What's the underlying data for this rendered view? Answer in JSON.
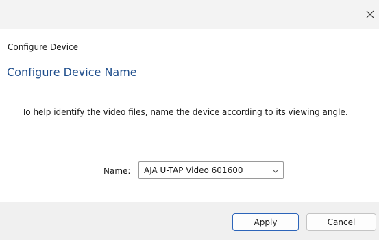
{
  "dialog": {
    "window_title": "Configure Device",
    "heading": "Configure Device Name",
    "description": "To help identify the video files, name the device according to its viewing angle.",
    "close_icon": "close-icon"
  },
  "name_field": {
    "label": "Name:",
    "selected_value": "AJA U-TAP Video 601600",
    "chevron_icon": "chevron-down-icon"
  },
  "buttons": {
    "apply_label": "Apply",
    "cancel_label": "Cancel"
  },
  "colors": {
    "heading": "#1f4e8c",
    "primary_border": "#2c64b9",
    "footer_bg": "#f0f0f0"
  }
}
